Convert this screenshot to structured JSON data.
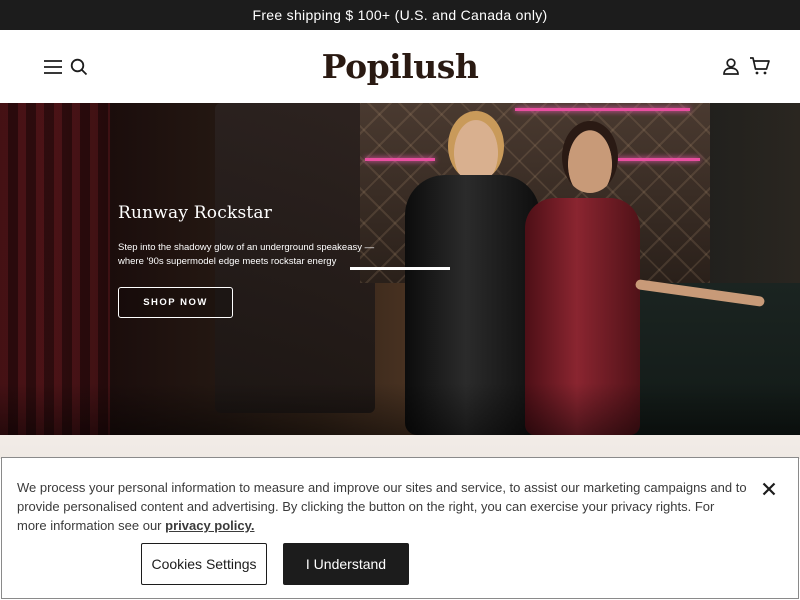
{
  "announcement": {
    "text": "Free shipping $ 100+ (U.S. and Canada only)"
  },
  "header": {
    "logo": "Popilush",
    "icons": {
      "menu": "hamburger-menu-icon",
      "search": "search-icon",
      "account": "user-icon",
      "cart": "cart-icon"
    }
  },
  "hero": {
    "title": "Runway Rockstar",
    "description": "Step into the shadowy glow of an underground speakeasy —where '90s supermodel edge meets rockstar energy",
    "cta": "SHOP NOW"
  },
  "cookie_banner": {
    "text": "We process your personal information to measure and improve our sites and service, to assist our marketing campaigns and to provide personalised content and advertising. By clicking the button on the right, you can exercise your privacy rights. For more information see our",
    "link_text": "privacy policy.",
    "settings_button": "Cookies Settings",
    "accept_button": "I Understand",
    "close_icon": "close-icon"
  },
  "colors": {
    "primary": "#1c1c1c",
    "neon": "#e84fa0",
    "dress_red": "#7a1a24",
    "background_strip": "#f2ece7"
  }
}
